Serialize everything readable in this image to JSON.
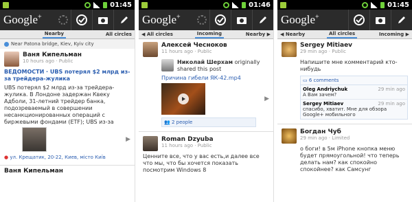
{
  "status": {
    "time1": "01:45",
    "time2": "01:46",
    "time3": "01:45"
  },
  "app": {
    "logo": "Google",
    "plus": "+"
  },
  "screen1": {
    "tab_left": "",
    "tab_center": "Nearby",
    "tab_right": "All circles",
    "location": "Near Patona bridge, Kiev, Kyiv city",
    "post": {
      "author": "Ваня Кипельман",
      "meta": "10 hours ago · Public",
      "link_title": "ВЕДОМОСТИ · UBS потерял $2 млрд из-за трейдера-жулика",
      "text": "UBS потерял $2 млрд из-за трейдера-жулика. В Лондоне задержан Квеку Адболи, 31-летний трейдер банка, подозреваемый в совершении несанкционированных операций с биржевыми фондами (ETF); UBS из-за трейдер может п...",
      "place": "ул. Крещатик, 20-22, Киев, місто Київ"
    },
    "next_author": "Ваня Кипельман"
  },
  "screen2": {
    "tab_left": "◀ All circles",
    "tab_center": "Incoming",
    "tab_right": "Nearby ▶",
    "post1": {
      "author": "Алексей Чесноков",
      "meta": "11 hours ago · Public",
      "shared_by": "Николай Шерхам",
      "shared_text": "originally shared this post",
      "video_title": "Причина гибели ЯК-42.mp4",
      "people": "2 people"
    },
    "post2": {
      "author": "Roman Dzyuba",
      "meta": "11 hours ago · Public",
      "text": "Ценните все, что у вас есть,и далее все что мы, что бы хочется показать посмотрим Windows 8"
    }
  },
  "screen3": {
    "tab_left": "◀ Nearby",
    "tab_center": "All circles",
    "tab_right": "Incoming ▶",
    "post1": {
      "author": "Sergey Mitiaev",
      "meta": "29 min ago · Public",
      "text": "Напишите мне комментарий кто-нибудь",
      "comments": "6 comments",
      "c1_author": "Oleg Andriychuk",
      "c1_time": "29 min ago",
      "c1_text": "А Вам зачем?",
      "c2_author": "Sergey Mitiaev",
      "c2_time": "29 min ago",
      "c2_text": "спасибо, хватит. Мне для обзора Google+ мобильного"
    },
    "post2": {
      "author": "Богдан Чуб",
      "meta": "29 min ago · Limited",
      "text": "о боги! в 5м iPhone кнопка меню будет прямоугольной! что теперь делать нам? как спокойно спокойнее? как Самсунг"
    }
  }
}
